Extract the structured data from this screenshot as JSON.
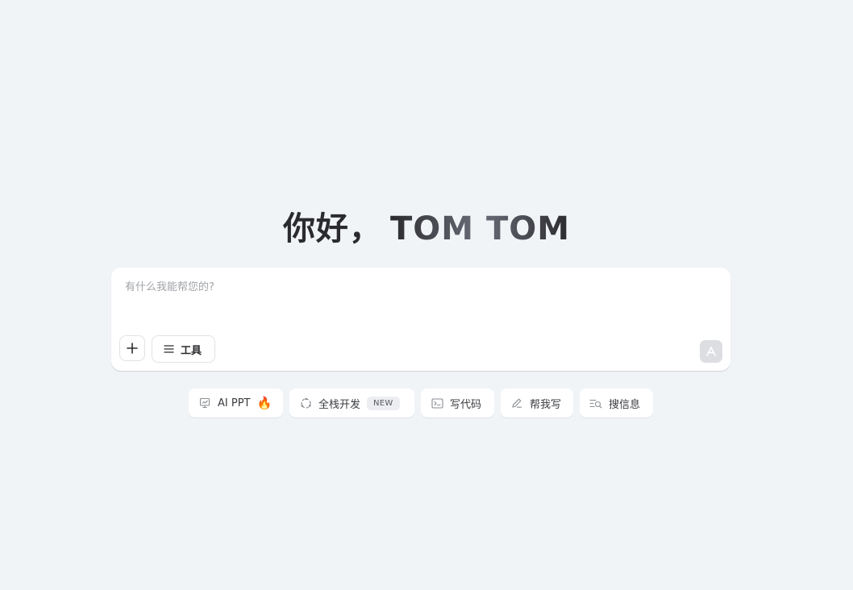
{
  "greeting": {
    "hello": "你好，",
    "name": "TOM TOM"
  },
  "composer": {
    "placeholder": "有什么我能帮您的?",
    "value": "",
    "add_icon": "plus-icon",
    "tools_label": "工具",
    "tools_icon": "menu-lines-icon",
    "send_icon": "send-arrow-icon"
  },
  "suggestions": [
    {
      "label": "AI PPT",
      "icon": "presentation-icon",
      "extra": "🔥"
    },
    {
      "label": "全栈开发",
      "icon": "dashed-circle-icon",
      "badge": "NEW"
    },
    {
      "label": "写代码",
      "icon": "terminal-icon"
    },
    {
      "label": "帮我写",
      "icon": "pencil-icon"
    },
    {
      "label": "搜信息",
      "icon": "search-list-icon"
    }
  ],
  "colors": {
    "background": "#f1f4f7",
    "card": "#ffffff",
    "text": "#2b2b2e",
    "send_disabled": "#dcdee2"
  }
}
